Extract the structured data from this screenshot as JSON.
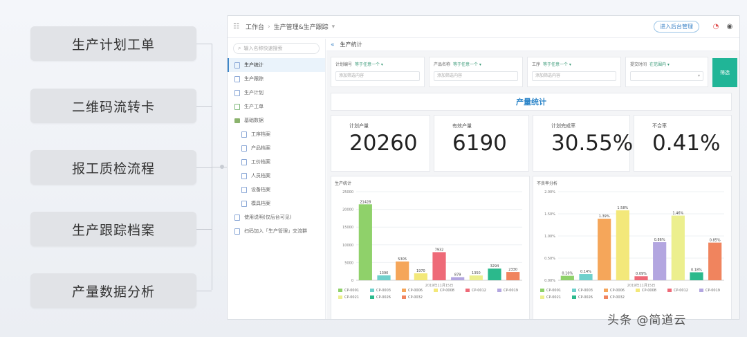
{
  "features": [
    "生产计划工单",
    "二维码流转卡",
    "报工质检流程",
    "生产跟踪档案",
    "产量数据分析"
  ],
  "topbar": {
    "crumb_home": "工作台",
    "crumb_current": "生产管理&生产跟踪",
    "manage_button": "进入后台管理"
  },
  "sidebar": {
    "search_placeholder": "输入名称快速搜索",
    "items": [
      "生产统计",
      "生产跟踪",
      "生产计划",
      "生产工单",
      "基础数据"
    ],
    "sub_items": [
      "工序档案",
      "产品档案",
      "工价档案",
      "人员档案",
      "设备档案",
      "模具档案"
    ],
    "extra_items": [
      "使用说明(仅后台可见)",
      "扫码加入「生产管理」交流群"
    ]
  },
  "main": {
    "header": "生产统计",
    "filters": [
      {
        "label": "计划编号",
        "tag": "等于任意一个 ▾",
        "placeholder": "添加筛选内容"
      },
      {
        "label": "产品名称",
        "tag": "等于任意一个 ▾",
        "placeholder": "添加筛选内容"
      },
      {
        "label": "工序",
        "tag": "等于任意一个 ▾",
        "placeholder": "添加筛选内容"
      },
      {
        "label": "提交时间",
        "tag": "在范围内 ▾",
        "placeholder": ""
      }
    ],
    "query_button": "筛选",
    "section_title": "产量统计",
    "kpis": [
      {
        "label": "计划产量",
        "value": "20260"
      },
      {
        "label": "有效产量",
        "value": "6190"
      },
      {
        "label": "计划完成率",
        "value": "30.55%"
      },
      {
        "label": "不合率",
        "value": "0.41%"
      }
    ]
  },
  "watermark": "头条 @简道云",
  "chart_data": [
    {
      "type": "bar",
      "title": "生产统计",
      "xlabel": "2019年11月15日",
      "ylim": [
        0,
        25000
      ],
      "yticks": [
        "0",
        "5000",
        "10000",
        "15000",
        "20000",
        "25000"
      ],
      "categories": [
        "CP-0001",
        "CP-0003",
        "CP-0006",
        "CP-0008",
        "CP-0012",
        "CP-0019",
        "CP-0021",
        "CP-0026",
        "CP-0032"
      ],
      "values": [
        21428,
        1390,
        5305,
        1970,
        7932,
        879,
        1350,
        3294,
        2330
      ],
      "labels": [
        "21428",
        "1390",
        "5305",
        "1970",
        "7932",
        "879",
        "1350",
        "3294",
        "2330"
      ],
      "colors": [
        "#8fd16a",
        "#6fd0cc",
        "#f5a65a",
        "#f3e87a",
        "#ee6a78",
        "#b3a6e0",
        "#ecef8e",
        "#2bb98c",
        "#f0845e"
      ]
    },
    {
      "type": "bar",
      "title": "不良率分析",
      "xlabel": "2019年11月15日",
      "ylim": [
        0,
        2.0
      ],
      "yticks": [
        "0.00%",
        "0.50%",
        "1.00%",
        "1.50%",
        "2.00%"
      ],
      "categories": [
        "CP-0001",
        "CP-0003",
        "CP-0006",
        "CP-0008",
        "CP-0012",
        "CP-0019",
        "CP-0021",
        "CP-0026",
        "CP-0032"
      ],
      "values": [
        0.1,
        0.14,
        1.39,
        1.58,
        0.09,
        0.86,
        1.46,
        0.18,
        0.85
      ],
      "labels": [
        "0.10%",
        "0.14%",
        "1.39%",
        "1.58%",
        "0.09%",
        "0.86%",
        "1.46%",
        "0.18%",
        "0.85%"
      ],
      "colors": [
        "#8fd16a",
        "#6fd0cc",
        "#f5a65a",
        "#f3e87a",
        "#ee6a78",
        "#b3a6e0",
        "#ecef8e",
        "#2bb98c",
        "#f0845e"
      ]
    }
  ]
}
